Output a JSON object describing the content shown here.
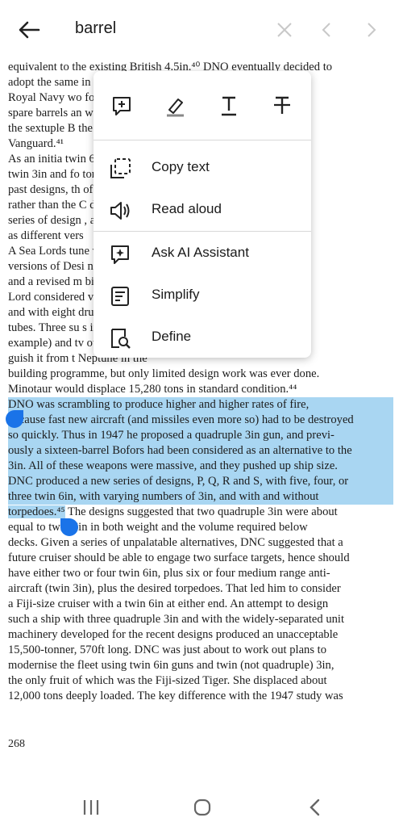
{
  "search": {
    "query": "barrel"
  },
  "menu": {
    "tools": [
      "add-comment",
      "highlight",
      "underline",
      "strikethrough"
    ],
    "items": [
      {
        "label": "Copy text",
        "icon": "copy-text-icon"
      },
      {
        "label": "Read aloud",
        "icon": "speaker-icon"
      },
      {
        "label": "Ask AI Assistant",
        "icon": "ai-sparkle-icon"
      },
      {
        "label": "Simplify",
        "icon": "simplify-icon"
      },
      {
        "label": "Define",
        "icon": "define-icon"
      }
    ]
  },
  "document": {
    "lines": [
      {
        "text": "equivalent to the existing British 4.5in.⁴⁰ DNO eventually decided to"
      },
      {
        "text": "adopt the same                                                        in wartime the"
      },
      {
        "text": "Royal Navy wo                                                      for supplies of"
      },
      {
        "text": "spare barrels an                                                   were based on"
      },
      {
        "text": "the sextuple B                                                    the battleship"
      },
      {
        "text": "Vanguard.⁴¹"
      },
      {
        "text": "     As an initia                                                    twin 6in, ten"
      },
      {
        "text": "twin 3in and fo                                                 tons. Based on"
      },
      {
        "text": "past designs, th                                               of 15,960 tons"
      },
      {
        "text": "rather than the                                                 C developed a"
      },
      {
        "text": "series of design                                               , all designated"
      },
      {
        "text": "as different vers"
      },
      {
        "text": "     A Sea Lords                                                 tune with three"
      },
      {
        "text": "versions of Desi                                              nd D with five"
      },
      {
        "text": "and a revised m                                              bility. First Sea"
      },
      {
        "text": "Lord considered                                               ve twin Mk 26"
      },
      {
        "text": "and with eight                                                 druple torpedo"
      },
      {
        "text": "tubes. Three su                                               s in a Dido, for"
      },
      {
        "text": "example) and tv                                               otaur, to distin-"
      },
      {
        "text": "guish it from t                                               Neptune in the"
      },
      {
        "text": "building programme, but only limited design work was ever done."
      },
      {
        "text": "Minotaur would displace 15,280 tons in standard condition.⁴⁴"
      },
      {
        "text": "     DNO was scrambling to produce higher and higher rates of fire,",
        "hl": true
      },
      {
        "text": "because fast new aircraft (and missiles even more so) had to be destroyed",
        "hl": true
      },
      {
        "text": "so quickly. Thus in 1947 he proposed a quadruple 3in gun, and previ-",
        "hl": true
      },
      {
        "text": "ously a sixteen-barrel Bofors had been considered as an alternative to the",
        "hl": true
      },
      {
        "text": "3in. All of these weapons were massive, and they pushed up ship size.",
        "hl": true
      },
      {
        "text": "DNC produced a new series of designs, P, Q, R and S, with five, four, or",
        "hl": true
      },
      {
        "text": "three twin 6in, with varying numbers of 3in, and with and without",
        "hl": true
      },
      {
        "text": "torpedoes.⁴⁵ The designs suggested that two quadruple 3in were about",
        "hlPart": "torpedoes.⁴⁵",
        "rest": " The designs suggested that two quadruple 3in were about"
      },
      {
        "text": "equal to        twin 6in in both weight and the volume required below"
      },
      {
        "text": "decks. Given a series of unpalatable alternatives, DNC suggested that a"
      },
      {
        "text": "future cruiser should be able to engage two surface targets, hence should"
      },
      {
        "text": "have either two or four twin 6in, plus six or four medium range anti-"
      },
      {
        "text": "aircraft (twin 3in), plus the desired torpedoes. That led him to consider"
      },
      {
        "text": "a Fiji-size cruiser with a twin 6in at either end. An attempt to design"
      },
      {
        "text": "such a ship with three quadruple 3in and with the widely-separated unit"
      },
      {
        "text": "machinery developed for the recent designs produced an unacceptable"
      },
      {
        "text": "15,500-tonner, 570ft long. DNC was just about to work out plans to"
      },
      {
        "text": "modernise the fleet using twin 6in guns and twin (not quadruple) 3in,"
      },
      {
        "text": "the only fruit of which was the Fiji-sized Tiger. She displaced about"
      },
      {
        "text": "12,000 tons deeply loaded. The key difference with the 1947 study was"
      }
    ],
    "page_number": "268"
  },
  "colors": {
    "accent": "#1a73e8",
    "highlight": "#a9d6f2"
  }
}
